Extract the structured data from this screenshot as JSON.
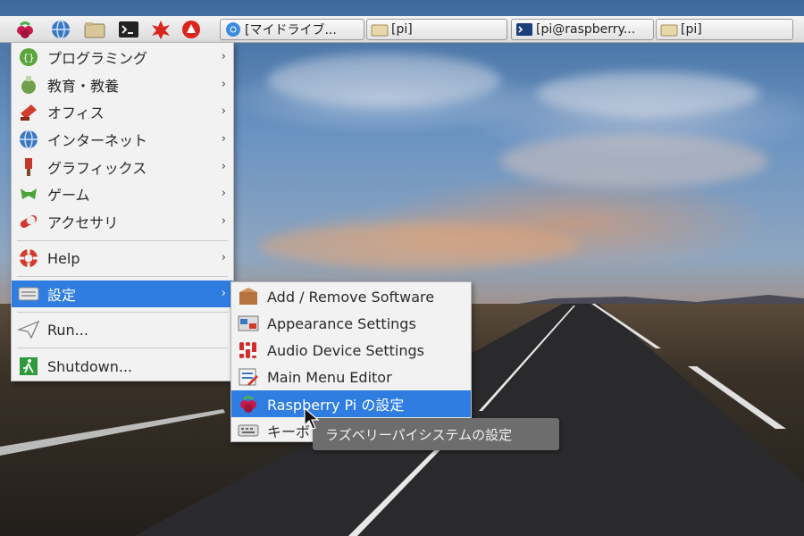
{
  "panel": {
    "tasks": [
      {
        "label": "[マイドライブ..."
      },
      {
        "label": "[pi]"
      },
      {
        "label": "[pi@raspberry..."
      },
      {
        "label": "[pi]"
      }
    ]
  },
  "menu": {
    "items": [
      {
        "label": "プログラミング",
        "icon": "programming-icon"
      },
      {
        "label": "教育・教養",
        "icon": "education-icon"
      },
      {
        "label": "オフィス",
        "icon": "office-icon"
      },
      {
        "label": "インターネット",
        "icon": "internet-globe-icon"
      },
      {
        "label": "グラフィックス",
        "icon": "graphics-icon"
      },
      {
        "label": "ゲーム",
        "icon": "games-icon"
      },
      {
        "label": "アクセサリ",
        "icon": "accessories-icon"
      },
      {
        "label": "Help",
        "icon": "help-lifebuoy-icon"
      },
      {
        "label": "設定",
        "icon": "preferences-icon"
      },
      {
        "label": "Run...",
        "icon": "run-icon"
      },
      {
        "label": "Shutdown...",
        "icon": "shutdown-icon"
      }
    ]
  },
  "submenu": {
    "items": [
      {
        "label": "Add / Remove Software",
        "icon": "package-icon"
      },
      {
        "label": "Appearance Settings",
        "icon": "appearance-icon"
      },
      {
        "label": "Audio Device Settings",
        "icon": "audio-icon"
      },
      {
        "label": "Main Menu Editor",
        "icon": "menu-editor-icon"
      },
      {
        "label": "Raspberry Pi の設定",
        "icon": "raspberry-icon"
      },
      {
        "label": "キーボ",
        "icon": "keyboard-icon"
      }
    ]
  },
  "tooltip": {
    "text": "ラズベリーパイシステムの設定"
  },
  "colors": {
    "highlight": "#2f7de1",
    "menu_bg": "#f2f2f2",
    "tooltip_bg": "#6d6d6d"
  }
}
